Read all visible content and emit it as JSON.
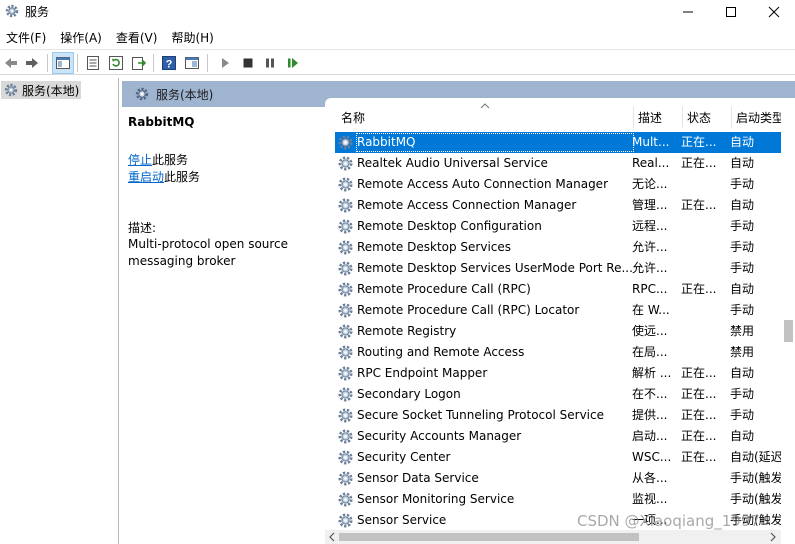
{
  "window": {
    "title": "服务",
    "controls": {
      "minimize": "minimize-icon",
      "maximize": "maximize-icon",
      "close": "close-icon"
    }
  },
  "menubar": {
    "items": [
      "文件(F)",
      "操作(A)",
      "查看(V)",
      "帮助(H)"
    ]
  },
  "toolbar": {
    "icons": [
      "back-arrow-icon",
      "forward-arrow-icon",
      "console-tree-icon",
      "properties-list-icon",
      "refresh-icon",
      "export-icon",
      "help-icon",
      "view-icon",
      "play-icon",
      "stop-icon",
      "pause-icon",
      "restart-icon"
    ]
  },
  "tree": {
    "item_label": "服务(本地)"
  },
  "panel": {
    "header_label": "服务(本地)",
    "selected_service": "RabbitMQ",
    "actions": [
      {
        "link": "停止",
        "suffix": "此服务"
      },
      {
        "link": "重启动",
        "suffix": "此服务"
      }
    ],
    "description_label": "描述:",
    "description_text": "Multi-protocol open source messaging broker"
  },
  "list": {
    "columns": [
      "名称",
      "描述",
      "状态",
      "启动类型"
    ],
    "rows": [
      {
        "name": "RabbitMQ",
        "desc": "Mult...",
        "status": "正在...",
        "start": "自动",
        "selected": true
      },
      {
        "name": "Realtek Audio Universal Service",
        "desc": "Real...",
        "status": "正在...",
        "start": "自动"
      },
      {
        "name": "Remote Access Auto Connection Manager",
        "desc": "无论...",
        "status": "",
        "start": "手动"
      },
      {
        "name": "Remote Access Connection Manager",
        "desc": "管理...",
        "status": "正在...",
        "start": "自动"
      },
      {
        "name": "Remote Desktop Configuration",
        "desc": "远程...",
        "status": "",
        "start": "手动"
      },
      {
        "name": "Remote Desktop Services",
        "desc": "允许...",
        "status": "",
        "start": "手动"
      },
      {
        "name": "Remote Desktop Services UserMode Port Re...",
        "desc": "允许...",
        "status": "",
        "start": "手动"
      },
      {
        "name": "Remote Procedure Call (RPC)",
        "desc": "RPC...",
        "status": "正在...",
        "start": "自动"
      },
      {
        "name": "Remote Procedure Call (RPC) Locator",
        "desc": "在 W...",
        "status": "",
        "start": "手动"
      },
      {
        "name": "Remote Registry",
        "desc": "使远...",
        "status": "",
        "start": "禁用"
      },
      {
        "name": "Routing and Remote Access",
        "desc": "在局...",
        "status": "",
        "start": "禁用"
      },
      {
        "name": "RPC Endpoint Mapper",
        "desc": "解析 ...",
        "status": "正在...",
        "start": "自动"
      },
      {
        "name": "Secondary Logon",
        "desc": "在不...",
        "status": "正在...",
        "start": "手动"
      },
      {
        "name": "Secure Socket Tunneling Protocol Service",
        "desc": "提供...",
        "status": "正在...",
        "start": "手动"
      },
      {
        "name": "Security Accounts Manager",
        "desc": "启动...",
        "status": "正在...",
        "start": "自动"
      },
      {
        "name": "Security Center",
        "desc": "WSC...",
        "status": "正在...",
        "start": "自动(延迟"
      },
      {
        "name": "Sensor Data Service",
        "desc": "从各...",
        "status": "",
        "start": "手动(触发"
      },
      {
        "name": "Sensor Monitoring Service",
        "desc": "监视...",
        "status": "",
        "start": "手动(触发"
      },
      {
        "name": "Sensor Service",
        "desc": "一项...",
        "status": "",
        "start": "手动(触发"
      }
    ]
  },
  "watermark": "CSDN @Xiaoqiang_1997",
  "colors": {
    "selection": "#0078d7",
    "panel_header": "#9fb4cf",
    "link": "#0066cc"
  }
}
